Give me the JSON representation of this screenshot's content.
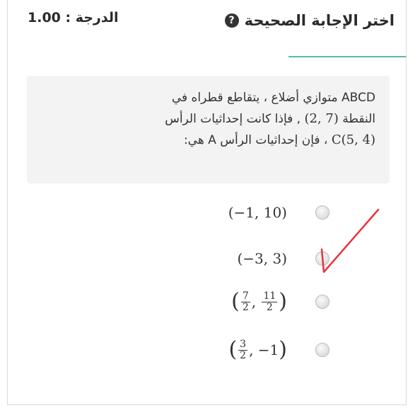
{
  "header": {
    "title": "اختر الإجابة الصحيحة",
    "grade": "الدرجة : 1.00"
  },
  "question": {
    "line1": "ABCD متوازي أضلاع ، يتقاطع قطراه في",
    "line2_text": "النقطة",
    "line2_math": "(2, 7)",
    "line2_rest": ", فإذا كانت إحداثيات الرأس",
    "line3_math": "C(5, 4)",
    "line3_rest": "، فإن إحداثيات الرأس A هي:"
  },
  "options": [
    {
      "label": "(−1, 10)",
      "selected": false
    },
    {
      "label": "(−3, 3)",
      "selected": false
    },
    {
      "label_parts": {
        "a_num": "7",
        "a_den": "2",
        "b_num": "11",
        "b_den": "2"
      },
      "selected": false
    },
    {
      "label_parts": {
        "a_num": "3",
        "a_den": "2",
        "b": "−1"
      },
      "selected": false
    }
  ],
  "colors": {
    "accent_rule": "#5bb6b8",
    "annotation": "#e8323c"
  }
}
